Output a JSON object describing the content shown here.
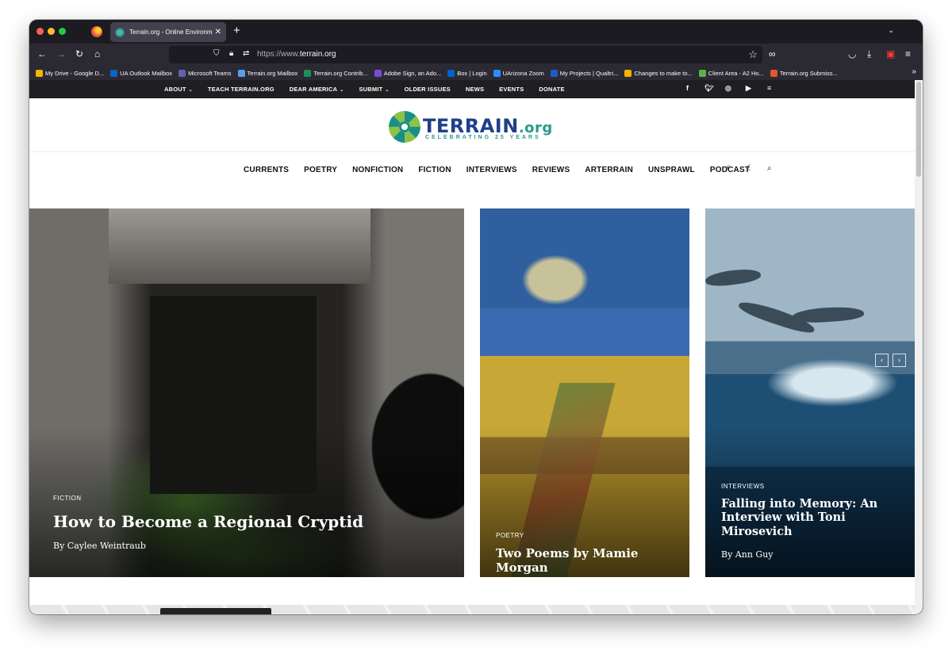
{
  "browser": {
    "tab_title": "Terrain.org - Online Environment",
    "url_scheme": "https://www.",
    "url_host": "terrain.org",
    "bookmarks": [
      {
        "label": "My Drive - Google D...",
        "color": "#f4b400"
      },
      {
        "label": "UA Outlook Mailbox",
        "color": "#0a64c2"
      },
      {
        "label": "Microsoft Teams",
        "color": "#6264a7"
      },
      {
        "label": "Terrain.org Mailbox",
        "color": "#5aa0e6"
      },
      {
        "label": "Terrain.org Contrib...",
        "color": "#1b8f5a"
      },
      {
        "label": "Adobe Sign, an Ado...",
        "color": "#7a4cd6"
      },
      {
        "label": "Box | Login",
        "color": "#0061d5"
      },
      {
        "label": "UArizona Zoom",
        "color": "#2d8cff"
      },
      {
        "label": "My Projects | Qualtri...",
        "color": "#1e5bc6"
      },
      {
        "label": "Changes to make to...",
        "color": "#f4b400"
      },
      {
        "label": "Client Area - A2 Ho...",
        "color": "#5fb04a"
      },
      {
        "label": "Terrain.org Submiss...",
        "color": "#e8542f"
      }
    ]
  },
  "site": {
    "top_nav": [
      {
        "label": "ABOUT",
        "dropdown": true
      },
      {
        "label": "TEACH TERRAIN.ORG",
        "dropdown": false
      },
      {
        "label": "DEAR AMERICA",
        "dropdown": true
      },
      {
        "label": "SUBMIT",
        "dropdown": true
      },
      {
        "label": "OLDER ISSUES",
        "dropdown": false
      },
      {
        "label": "NEWS",
        "dropdown": false
      },
      {
        "label": "EVENTS",
        "dropdown": false
      },
      {
        "label": "DONATE",
        "dropdown": false
      }
    ],
    "social": [
      "facebook-icon",
      "twitter-icon",
      "instagram-icon",
      "youtube-icon",
      "menu-icon"
    ],
    "logo": {
      "name": "TERRAIN",
      "suffix": ".org",
      "tagline": "CELEBRATING 25 YEARS"
    },
    "main_nav": [
      "CURRENTS",
      "POETRY",
      "NONFICTION",
      "FICTION",
      "INTERVIEWS",
      "REVIEWS",
      "ARTERRAIN",
      "UNSPRAWL",
      "PODCAST"
    ],
    "nav_icons": [
      "lightning-icon",
      "moon-icon",
      "search-icon"
    ],
    "featured": [
      {
        "category": "FICTION",
        "title": "How to Become a Regional Cryptid",
        "byline": "By Caylee Weintraub"
      },
      {
        "category": "POETRY",
        "title": "Two Poems by Mamie Morgan",
        "byline": ""
      },
      {
        "category": "INTERVIEWS",
        "title": "Falling into Memory: An Interview with Toni Mirosevich",
        "byline": "By Ann Guy"
      }
    ],
    "slider": {
      "prev": "‹",
      "next": "›"
    }
  },
  "colors": {
    "accent_teal": "#2a9a8a",
    "logo_blue": "#1f3f8a",
    "topbar": "#1f1f22"
  }
}
